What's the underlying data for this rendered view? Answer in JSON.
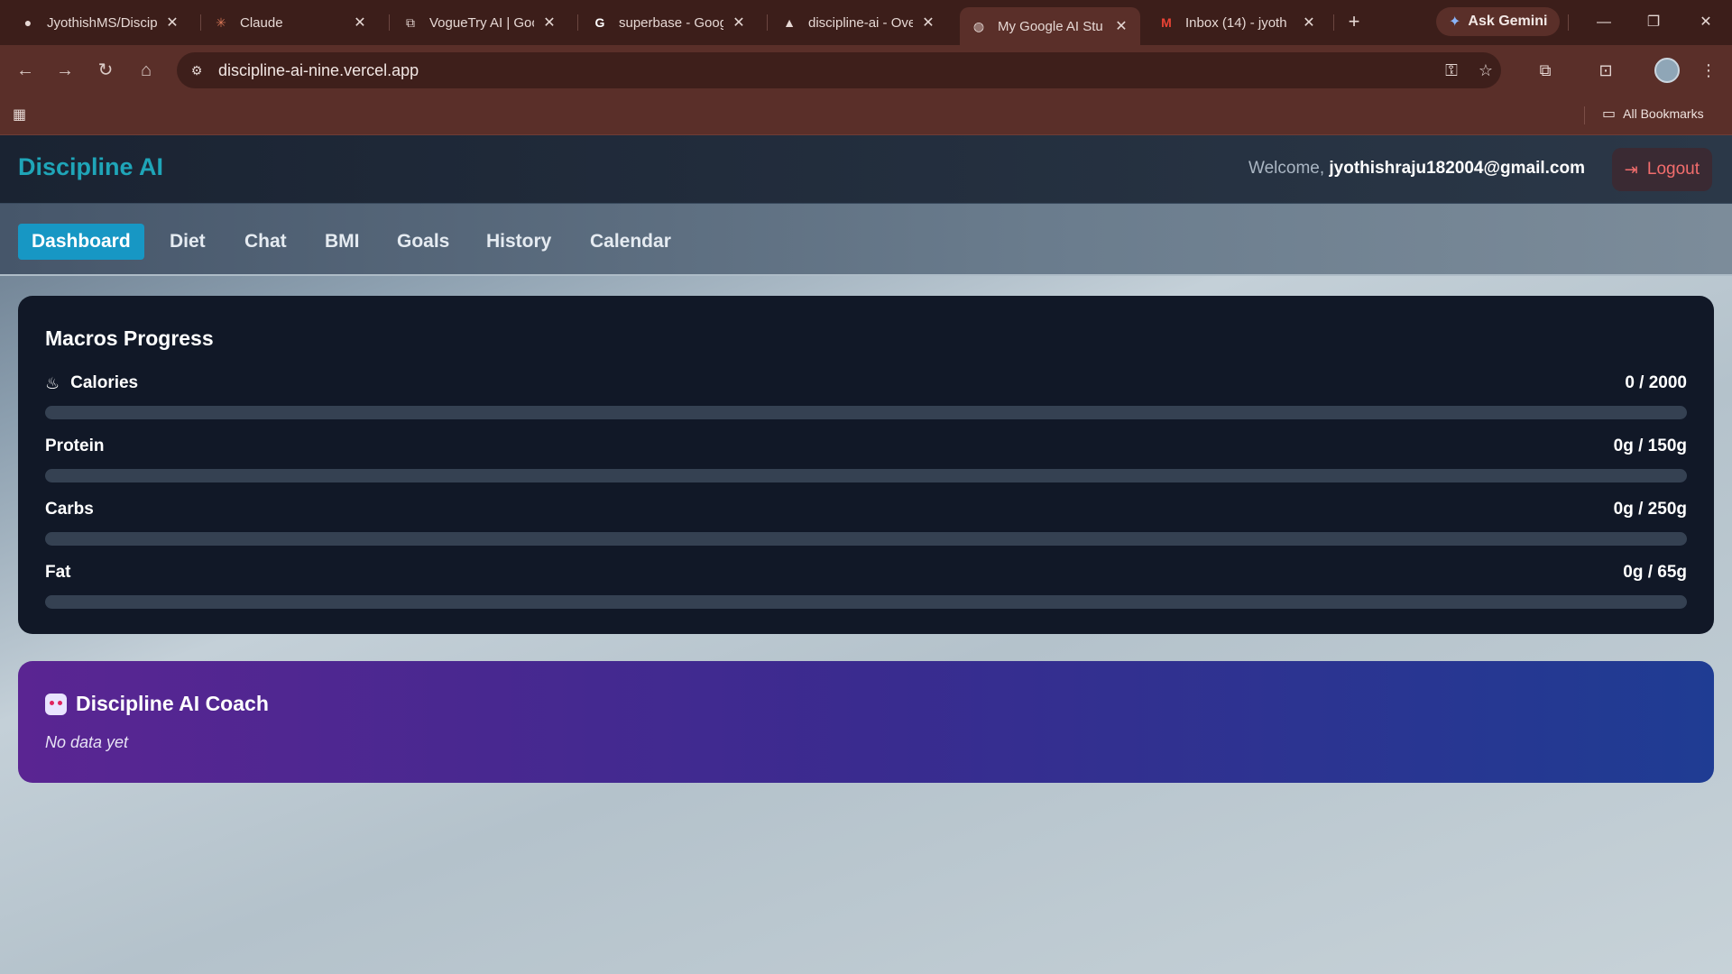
{
  "browser": {
    "tabs": [
      {
        "title": "JyothishMS/Discip",
        "icon": "github-icon",
        "active": false
      },
      {
        "title": "Claude",
        "icon": "claude-icon",
        "active": false
      },
      {
        "title": "VogueTry AI | Goo",
        "icon": "external-link-icon",
        "active": false
      },
      {
        "title": "superbase - Goog",
        "icon": "google-icon",
        "active": false
      },
      {
        "title": "discipline-ai - Ove",
        "icon": "vercel-icon",
        "active": false
      },
      {
        "title": "My Google AI Stu",
        "icon": "globe-icon",
        "active": true
      },
      {
        "title": "Inbox (14) - jyoth",
        "icon": "gmail-icon",
        "active": false
      }
    ],
    "ask_gemini": "Ask Gemini",
    "url": "discipline-ai-nine.vercel.app",
    "all_bookmarks": "All Bookmarks",
    "accent": "#5a2f29"
  },
  "app": {
    "brand": "Discipline AI",
    "welcome_prefix": "Welcome,",
    "user_email": "jyothishraju182004@gmail.com",
    "logout_label": "Logout",
    "nav": [
      {
        "label": "Dashboard",
        "active": true
      },
      {
        "label": "Diet",
        "active": false
      },
      {
        "label": "Chat",
        "active": false
      },
      {
        "label": "BMI",
        "active": false
      },
      {
        "label": "Goals",
        "active": false
      },
      {
        "label": "History",
        "active": false
      },
      {
        "label": "Calendar",
        "active": false
      }
    ],
    "macros": {
      "title": "Macros Progress",
      "items": [
        {
          "label": "Calories",
          "value": "0 / 2000",
          "progress": 0,
          "icon": "flame-icon"
        },
        {
          "label": "Protein",
          "value": "0g / 150g",
          "progress": 0
        },
        {
          "label": "Carbs",
          "value": "0g / 250g",
          "progress": 0
        },
        {
          "label": "Fat",
          "value": "0g / 65g",
          "progress": 0
        }
      ]
    },
    "coach": {
      "title": "Discipline AI Coach",
      "text": "No data yet",
      "icon": "robot-icon"
    },
    "colors": {
      "brand": "#1fa5b8",
      "active_tab": "#1797c4",
      "logout": "#f26d6d",
      "card_bg": "#111827"
    }
  }
}
